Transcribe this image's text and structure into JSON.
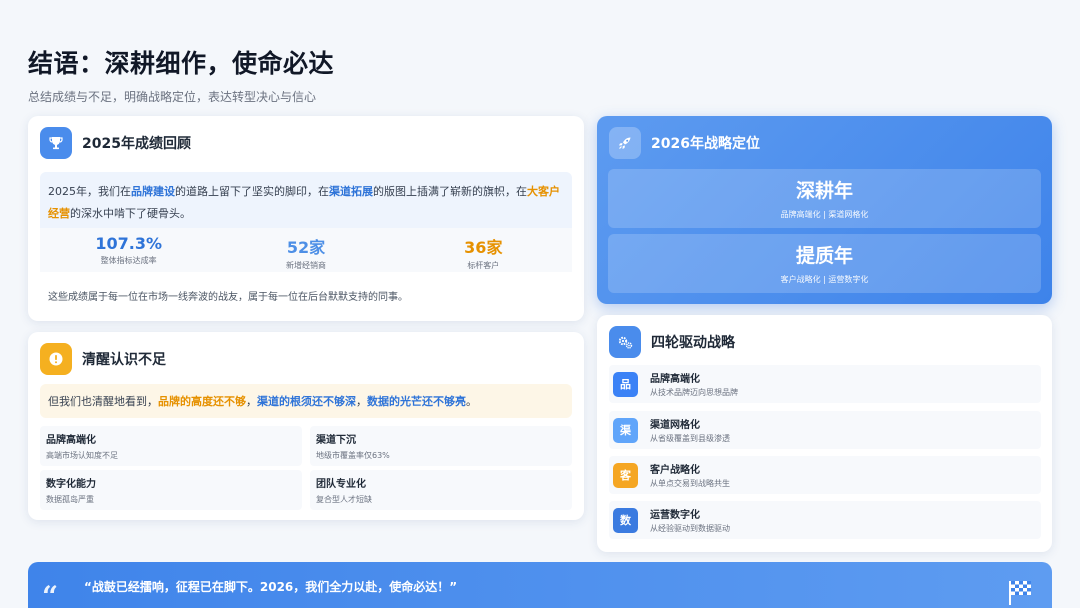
{
  "page": {
    "title": "结语：深耕细作，使命必达",
    "subtitle": "总结成绩与不足，明确战略定位，表达转型决心与信心"
  },
  "review": {
    "title": "2025年成绩回顾",
    "icon": "trophy-icon",
    "narrative": {
      "p1": "2025年，我们在",
      "h1": "品牌建设",
      "p2": "的道路上留下了坚实的脚印，在",
      "h2": "渠道拓展",
      "p3": "的版图上插满了崭新的旗帜，在",
      "h3": "大客户经营",
      "p4": "的深水中啃下了硬骨头。"
    },
    "stats": [
      {
        "value": "107.3%",
        "label": "整体指标达成率",
        "color": "#2f74d8"
      },
      {
        "value": "52家",
        "label": "新增经销商",
        "color": "#4d8fe6"
      },
      {
        "value": "36家",
        "label": "标杆客户",
        "color": "#e69100"
      }
    ],
    "thanks": "这些成绩属于每一位在市场一线奔波的战友，属于每一位在后台默默支持的同事。"
  },
  "awareness": {
    "title": "清醒认识不足",
    "icon": "alert-icon",
    "banner": {
      "p1": "但我们也清醒地看到，",
      "h1": "品牌的高度还不够",
      "s1": "，",
      "h2": "渠道的根须还不够深",
      "s2": "，",
      "h3": "数据的光芒还不够亮",
      "p2": "。"
    },
    "issues": [
      {
        "title": "品牌高端化",
        "desc": "高端市场认知度不足"
      },
      {
        "title": "渠道下沉",
        "desc": "地级市覆盖率仅63%"
      },
      {
        "title": "数字化能力",
        "desc": "数据孤岛严重"
      },
      {
        "title": "团队专业化",
        "desc": "复合型人才短缺"
      }
    ]
  },
  "strategy": {
    "title": "2026年战略定位",
    "icon": "rocket-icon",
    "items": [
      {
        "title": "深耕年",
        "desc": "品牌高端化 | 渠道网格化"
      },
      {
        "title": "提质年",
        "desc": "客户战略化 | 运营数字化"
      }
    ]
  },
  "drivers": {
    "title": "四轮驱动战略",
    "icon": "gears-icon",
    "items": [
      {
        "badge": "品",
        "title": "品牌高端化",
        "desc": "从技术品牌迈向思想品牌",
        "color": "#3b82f6"
      },
      {
        "badge": "渠",
        "title": "渠道网格化",
        "desc": "从省级覆盖到县级渗透",
        "color": "#60a5fa"
      },
      {
        "badge": "客",
        "title": "客户战略化",
        "desc": "从单点交易到战略共生",
        "color": "#f5a623"
      },
      {
        "badge": "数",
        "title": "运营数字化",
        "desc": "从经验驱动到数据驱动",
        "color": "#3b7be0"
      }
    ]
  },
  "quote": {
    "text": "“战鼓已经擂响，征程已在脚下。2026，我们全力以赴，使命必达！”",
    "sub": "",
    "mark": "“",
    "icon": "checkered-flag-icon"
  }
}
